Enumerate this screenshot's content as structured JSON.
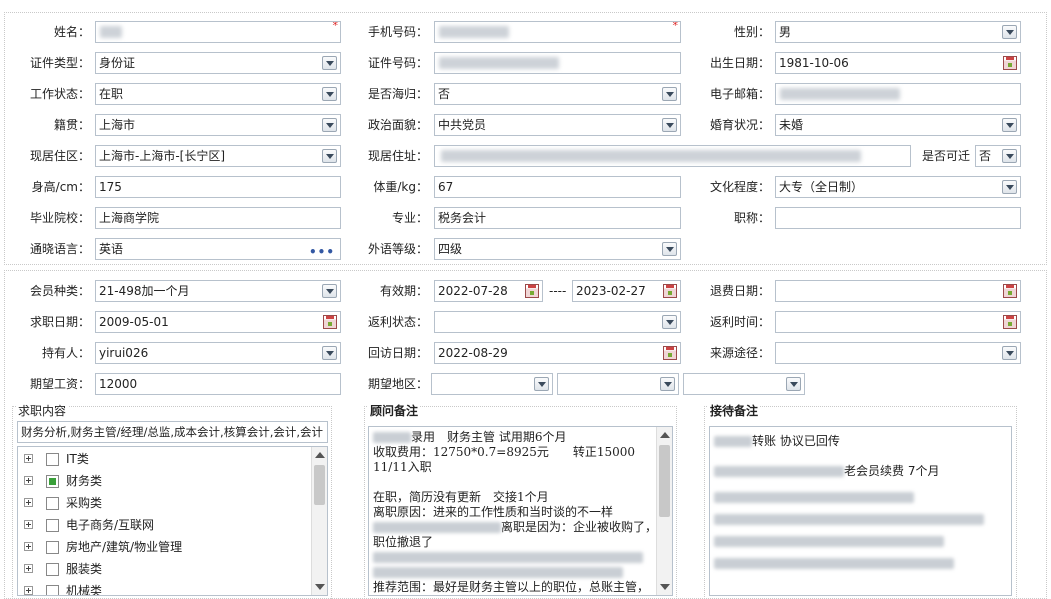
{
  "personal": {
    "name": {
      "label": "姓名："
    },
    "mobile": {
      "label": "手机号码："
    },
    "gender": {
      "label": "性别：",
      "value": "男"
    },
    "id_type": {
      "label": "证件类型：",
      "value": "身份证"
    },
    "id_number": {
      "label": "证件号码："
    },
    "birth_date": {
      "label": "出生日期：",
      "value": "1981-10-06"
    },
    "work_status": {
      "label": "工作状态：",
      "value": "在职"
    },
    "returnee": {
      "label": "是否海归：",
      "value": "否"
    },
    "email": {
      "label": "电子邮箱："
    },
    "native_place": {
      "label": "籍贯：",
      "value": "上海市"
    },
    "political_status": {
      "label": "政治面貌：",
      "value": "中共党员"
    },
    "marital_status": {
      "label": "婚育状况：",
      "value": "未婚"
    },
    "residence_area": {
      "label": "现居住区：",
      "value": "上海市-上海市-[长宁区]"
    },
    "residence_address": {
      "label": "现居住址："
    },
    "relocatable": {
      "label": "是否可迁",
      "value": "否"
    },
    "height": {
      "label": "身高/cm：",
      "value": "175"
    },
    "weight": {
      "label": "体重/kg：",
      "value": "67"
    },
    "education": {
      "label": "文化程度：",
      "value": "大专（全日制）"
    },
    "school": {
      "label": "毕业院校：",
      "value": "上海商学院"
    },
    "major": {
      "label": "专业：",
      "value": "税务会计"
    },
    "title": {
      "label": "职称："
    },
    "language": {
      "label": "通晓语言：",
      "value": "英语"
    },
    "language_level": {
      "label": "外语等级：",
      "value": "四级"
    }
  },
  "membership": {
    "member_type": {
      "label": "会员种类：",
      "value": "21-498加一个月"
    },
    "validity": {
      "label": "有效期：",
      "start": "2022-07-28",
      "separator": "----",
      "end": "2023-02-27"
    },
    "refund_date": {
      "label": "退费日期："
    },
    "job_seek_date": {
      "label": "求职日期：",
      "value": "2009-05-01"
    },
    "rebate_status": {
      "label": "返利状态："
    },
    "rebate_time": {
      "label": "返利时间："
    },
    "holder": {
      "label": "持有人：",
      "value": "yirui026"
    },
    "visit_date": {
      "label": "回访日期：",
      "value": "2022-08-29"
    },
    "source": {
      "label": "来源途径："
    },
    "expected_salary": {
      "label": "期望工资：",
      "value": "12000"
    },
    "expected_area": {
      "label": "期望地区："
    }
  },
  "job_content": {
    "title": "求职内容",
    "summary": "财务分析,财务主管/经理/总监,成本会计,核算会计,会计,会计",
    "tree": [
      {
        "label": "IT类",
        "checked": false
      },
      {
        "label": "财务类",
        "checked": true
      },
      {
        "label": "采购类",
        "checked": false
      },
      {
        "label": "电子商务/互联网",
        "checked": false
      },
      {
        "label": "房地产/建筑/物业管理",
        "checked": false
      },
      {
        "label": "服装类",
        "checked": false
      },
      {
        "label": "机械类",
        "checked": false
      }
    ]
  },
  "consultant_notes": {
    "title": "顾问备注",
    "lines": {
      "l1": "录用　财务主管 试用期6个月",
      "l2": "收取费用：12750*0.7=8925元　　转正15000",
      "l3": "11/11入职",
      "l4": "在职，简历没有更新　交接1个月",
      "l5": "离职原因：进来的工作性质和当时谈的不一样",
      "l6": "离职是因为：企业被收购了，",
      "l7": "职位撤退了",
      "l8": "推荐范围：最好是财务主管以上的职位，总账主管，"
    }
  },
  "reception_notes": {
    "title": "接待备注",
    "lines": {
      "l1": "转账 协议已回传",
      "l2": "老会员续费 7个月"
    }
  },
  "colors": {
    "required": "#d22222",
    "field_border": "#b7c1cc",
    "checked_box": "#3aa03a"
  }
}
